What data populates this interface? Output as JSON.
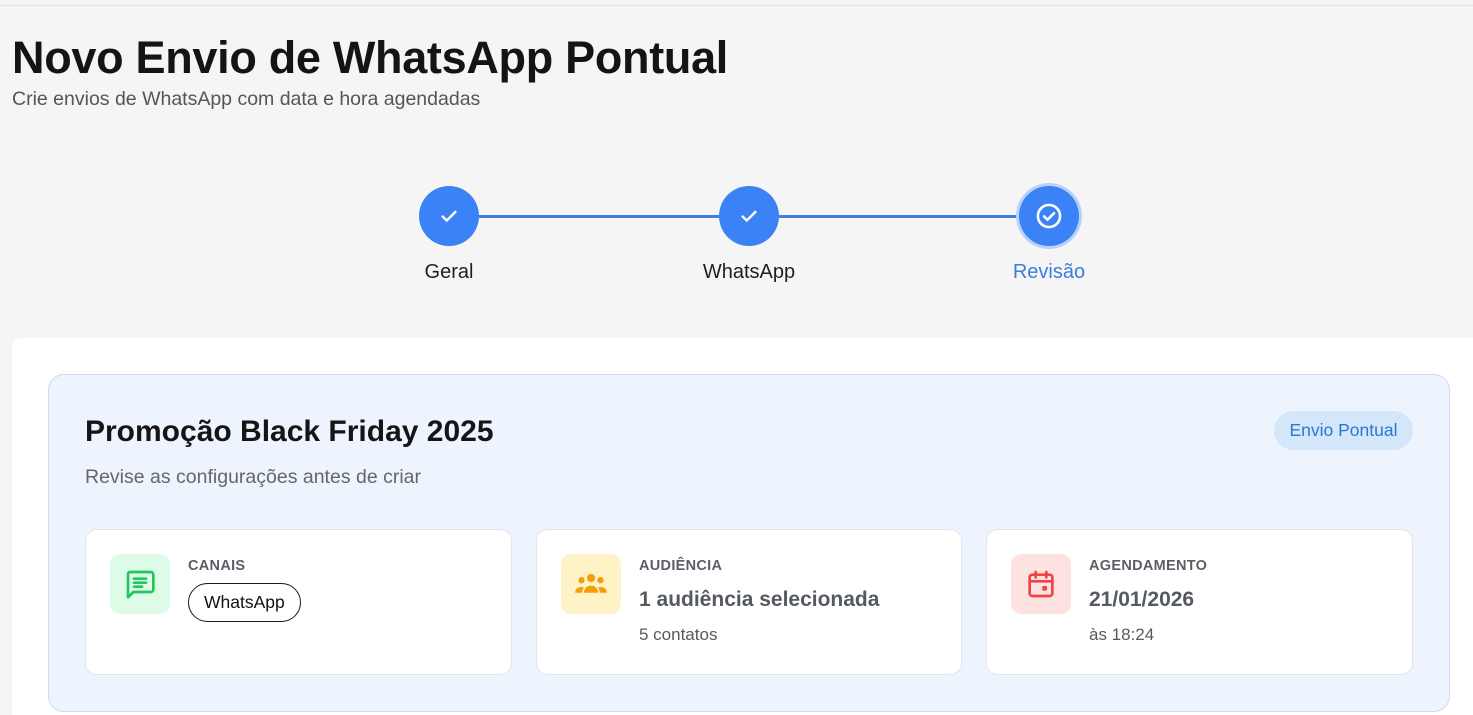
{
  "header": {
    "title": "Novo Envio de WhatsApp Pontual",
    "subtitle": "Crie envios de WhatsApp com data e hora agendadas"
  },
  "stepper": {
    "steps": [
      {
        "label": "Geral",
        "status": "completed",
        "icon": "check-icon"
      },
      {
        "label": "WhatsApp",
        "status": "completed",
        "icon": "check-icon"
      },
      {
        "label": "Revisão",
        "status": "current",
        "icon": "check-circle-icon"
      }
    ]
  },
  "review": {
    "title": "Promoção Black Friday 2025",
    "subtitle": "Revise as configurações antes de criar",
    "badge": "Envio Pontual",
    "cards": {
      "channels": {
        "label": "CANAIS",
        "chip": "WhatsApp",
        "icon": "message-icon"
      },
      "audience": {
        "label": "AUDIÊNCIA",
        "value": "1 audiência selecionada",
        "sub": "5 contatos",
        "icon": "group-icon"
      },
      "schedule": {
        "label": "AGENDAMENTO",
        "value": "21/01/2026",
        "sub": "às 18:24",
        "icon": "calendar-icon"
      }
    }
  },
  "colors": {
    "accent": "#3b82f6",
    "badge_bg": "#d3e6fa",
    "channels_icon_bg": "#dcfce7",
    "channels_icon": "#22c55e",
    "audience_icon_bg": "#fef3c7",
    "audience_icon": "#f59e0b",
    "schedule_icon_bg": "#fee2e2",
    "schedule_icon": "#ef4444"
  }
}
